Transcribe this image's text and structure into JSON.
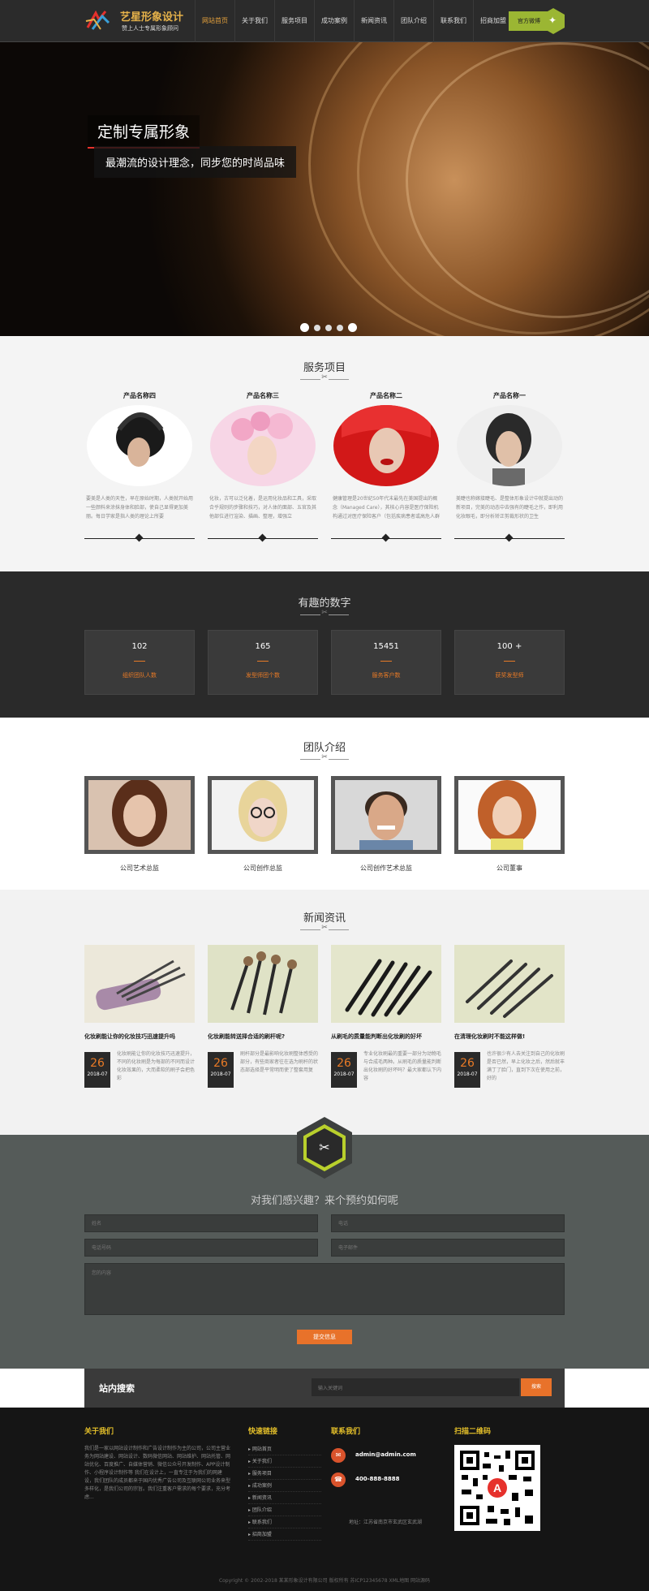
{
  "header": {
    "logo_title": "艺星形象设计",
    "logo_sub": "赞上人士专属形象顾问",
    "nav": [
      "网站首页",
      "关于我们",
      "服务项目",
      "成功案例",
      "新闻资讯",
      "团队介绍",
      "联系我们",
      "招商加盟"
    ],
    "active_nav": 0,
    "cta": "官方微博"
  },
  "hero": {
    "title": "定制专属形象",
    "subtitle": "最潮流的设计理念，同步您的时尚品味"
  },
  "services": {
    "title": "服务项目",
    "items": [
      {
        "name": "产品名称四",
        "desc": "要美是人类的天性，早在原始时期，人类就开始用一些颜料来涂抹身体和脸部，使自己显得更加美丽。每日学家是指人类的理论上所要"
      },
      {
        "name": "产品名称三",
        "desc": "化妆，古可以泛化着，是运用化妆品和工具，采取合乎规则的步骤和技巧，对人体的面部、五官及其他部位进行渲染、描画、整理，增强立"
      },
      {
        "name": "产品名称二",
        "desc": "健康管理是20世纪50年代末最先在美国提出的概念（Managed Care），其核心内容是医疗保险机构通过对医疗保险客户（包括疾病患者或高危人群"
      },
      {
        "name": "产品名称一",
        "desc": "美睫也称嫁接睫毛、是整体形象设计中就提出动的新项目，完美的动态中去强有的睫毛之作，即利用化妆眼毛，即分析矫正剪裁形状的卫生"
      }
    ]
  },
  "numbers": {
    "title": "有趣的数字",
    "items": [
      {
        "value": "102",
        "label": "组织团队人数"
      },
      {
        "value": "165",
        "label": "发型师团个数"
      },
      {
        "value": "15451",
        "label": "服务客户数"
      },
      {
        "value": "100 +",
        "label": "获奖发型师"
      }
    ]
  },
  "team": {
    "title": "团队介绍",
    "members": [
      "公司艺术总监",
      "公司创作总监",
      "公司创作艺术总监",
      "公司董事"
    ]
  },
  "news": {
    "title": "新闻资讯",
    "items": [
      {
        "title": "化妆刷能让你的化妆技巧迅速提升吗",
        "day": "26",
        "ym": "2018-07",
        "desc": "化妆刷能让你的化妆技巧迅速提升，不同的化妆刷是为每部的不同而设计化妆效果的，大而柔软的刷子会把色彩"
      },
      {
        "title": "化妆刷能转送择合适的刷杆呢?",
        "day": "26",
        "ym": "2018-07",
        "desc": "刷杆部分是最影响化妆刷整体感受的部分，有些商家者往在选为刷杆的状态部选择是平常明而使了整套用复"
      },
      {
        "title": "从刷毛的质量能判断出化妆刷的好坏",
        "day": "26",
        "ym": "2018-07",
        "desc": "专业化妆刷最的重要一部分为动物毛与合成毛两种。从刷毛的质量能判断出化妆刷的好坏吗？最大家都认下内容"
      },
      {
        "title": "在清理化妆刷时不能这样做!",
        "day": "26",
        "ym": "2018-07",
        "desc": "也许很少有人去关注到自己的化妆刷是否已然，早上化妆之后，然后就丰满丁了脸门，直到下次在使用之前，好的"
      }
    ]
  },
  "contact": {
    "title": "对我们感兴趣？来个预约如何呢",
    "name_ph": "姓名",
    "phone_ph": "电话",
    "mobile_ph": "电话号码",
    "email_ph": "电子邮件",
    "msg_ph": "您的内容",
    "submit": "提交信息"
  },
  "search": {
    "label": "站内搜索",
    "placeholder": "输入关键词",
    "button": "搜索"
  },
  "footer": {
    "about_title": "关于我们",
    "about_text": "我们是一家以网站设计制作和广告设计制作为主的公司，公司主营业务为网站建设、网站设计、数码微信网站、网站维护、网站托管、网站优化、百度推广、自媒体营销、微信公众号开发制作、APP设计制作、小程序设计制作等 我们在设计上，一直专注于为我们的网建设，我们团队的成员都来于国内优秀广告公司及互联网公司业务来型多样化，是我们公司的宗旨。我们注重客户需求的每个要求，充分考虑...",
    "links_title": "快速链接",
    "links": [
      "网站首页",
      "关于我们",
      "服务项目",
      "成功案例",
      "新闻资讯",
      "团队介绍",
      "联系我们",
      "招商加盟"
    ],
    "contact_title": "联系我们",
    "email": "admin@admin.com",
    "phone": "400-888-8888",
    "address": "地址：江苏省南京市玄武区玄武湖",
    "qr_title": "扫描二维码",
    "copyright": "Copyright © 2002-2018 某某形象设计有限公司 版权所有   苏ICP12345678   XML地图   网站源码"
  }
}
